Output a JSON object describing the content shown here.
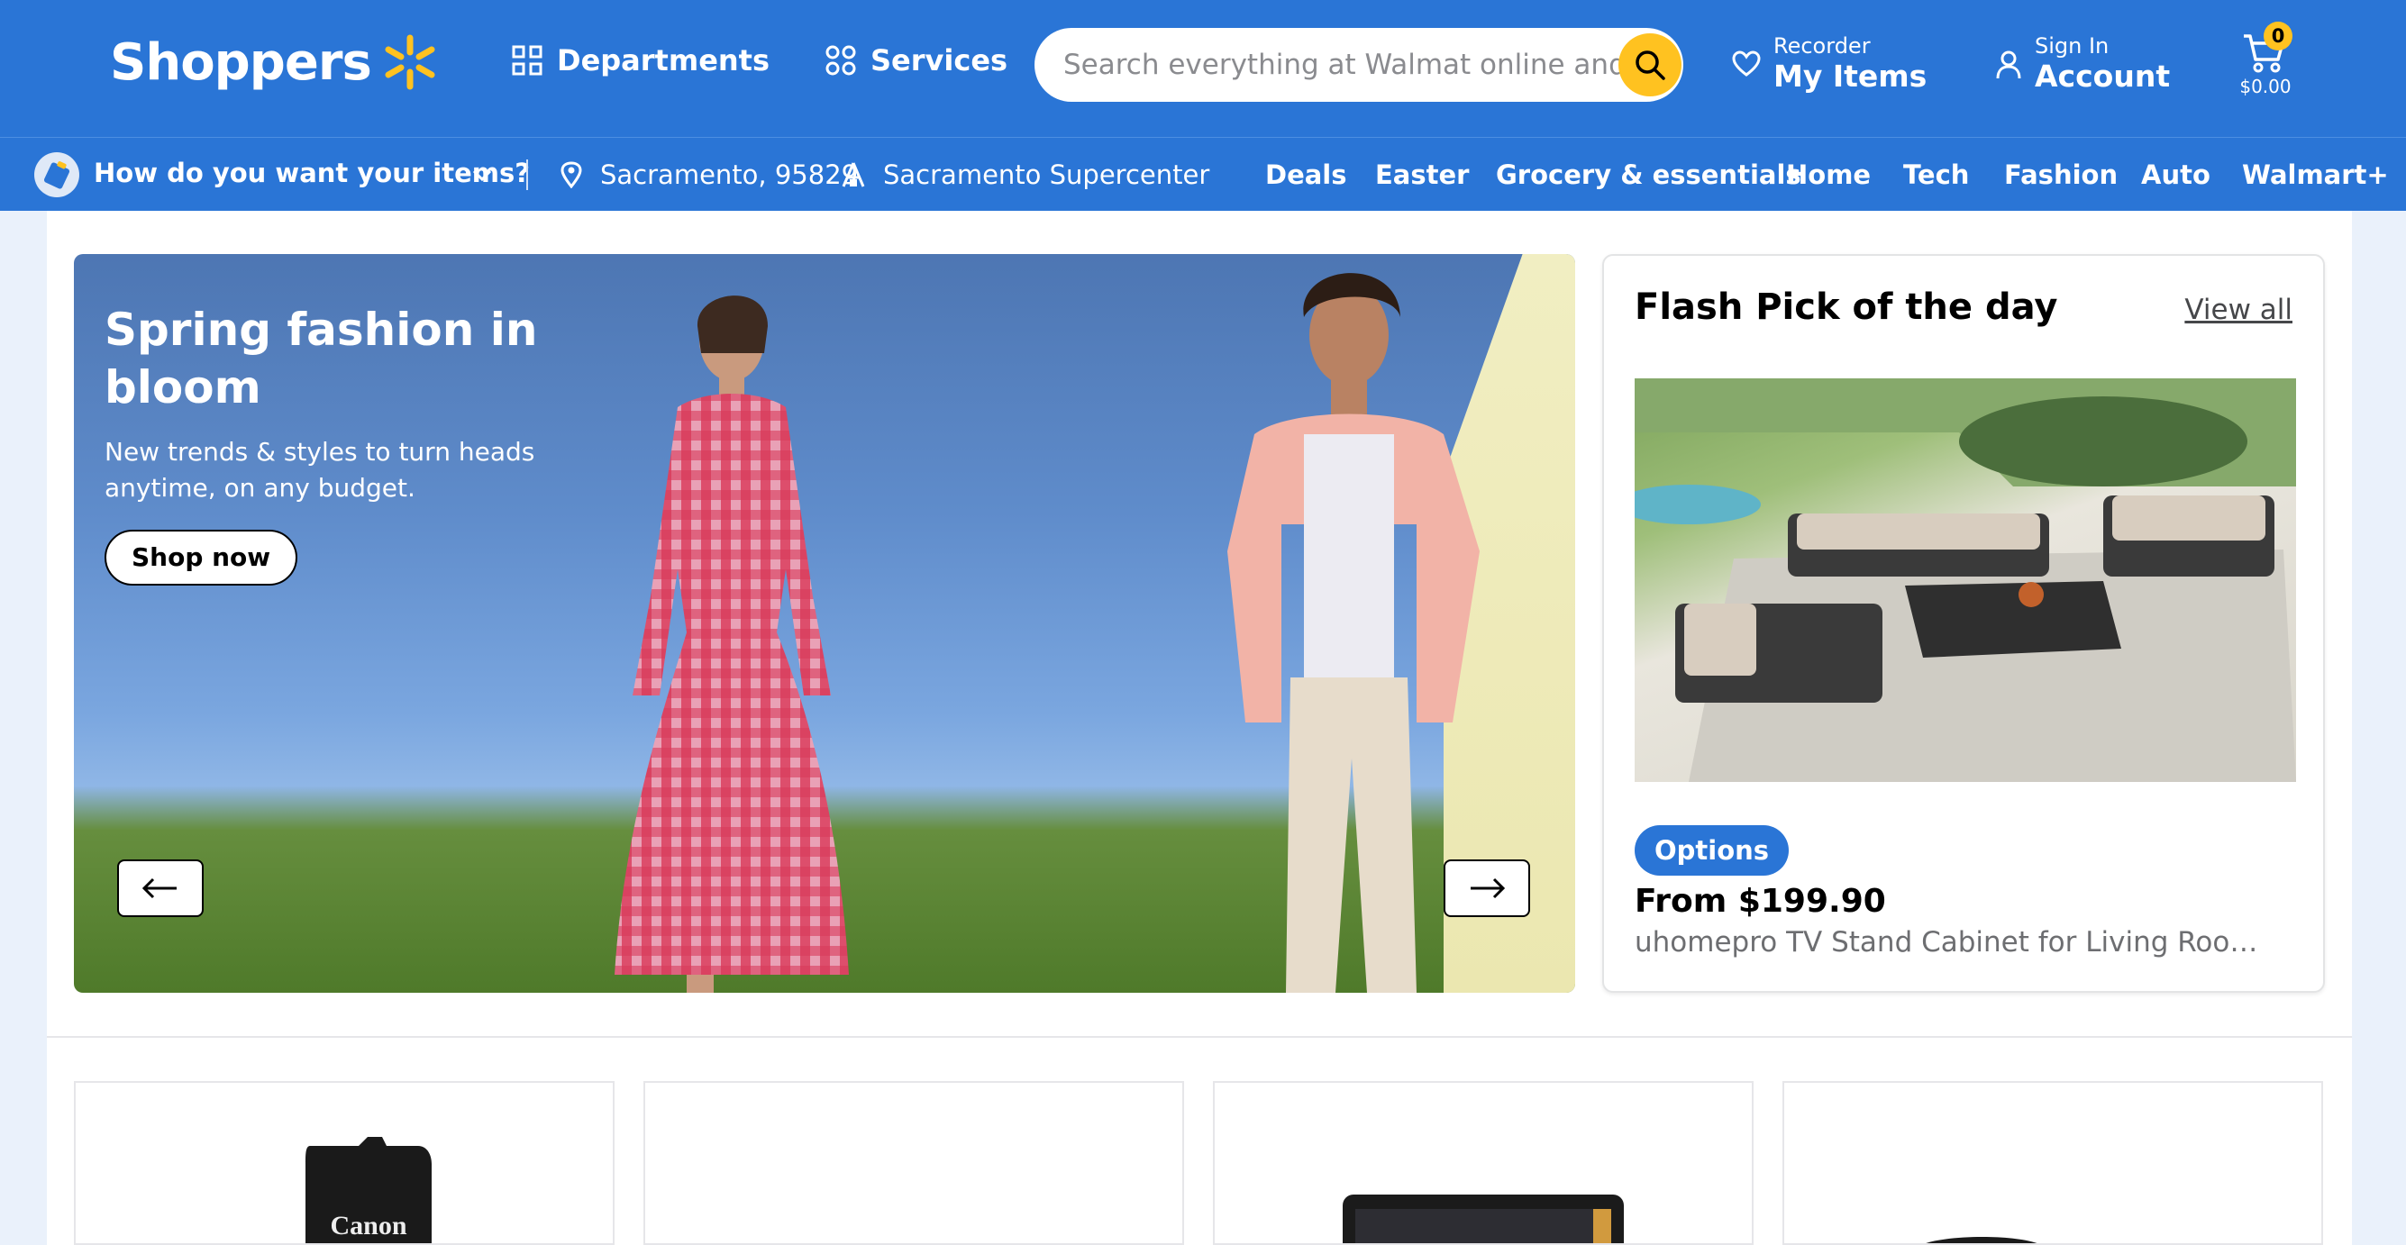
{
  "header": {
    "logo_text": "Shoppers",
    "departments_label": "Departments",
    "services_label": "Services",
    "search_placeholder": "Search everything at Walmat online and in store",
    "myitems_small": "Recorder",
    "myitems_big": "My Items",
    "account_small": "Sign In",
    "account_big": "Account",
    "cart_count": "0",
    "cart_total": "$0.00",
    "brand_color": "#2a75d6",
    "accent_color": "#ffc220"
  },
  "subheader": {
    "delivery_question": "How do you want your items?",
    "location": "Sacramento, 95829",
    "store": "Sacramento Supercenter",
    "nav": [
      "Deals",
      "Easter",
      "Grocery & essentials",
      "Home",
      "Tech",
      "Fashion",
      "Auto",
      "Walmart+"
    ]
  },
  "hero": {
    "title": "Spring fashion in bloom",
    "subtitle": "New trends & styles to turn heads anytime, on any budget.",
    "cta_label": "Shop now"
  },
  "flash_pick": {
    "title": "Flash Pick of the day",
    "view_all": "View all",
    "badge": "Options",
    "price": "From $199.90",
    "product_name": "uhomepro TV Stand Cabinet for Living Room..."
  },
  "tiles": {
    "tile_1_brand": "Canon"
  }
}
